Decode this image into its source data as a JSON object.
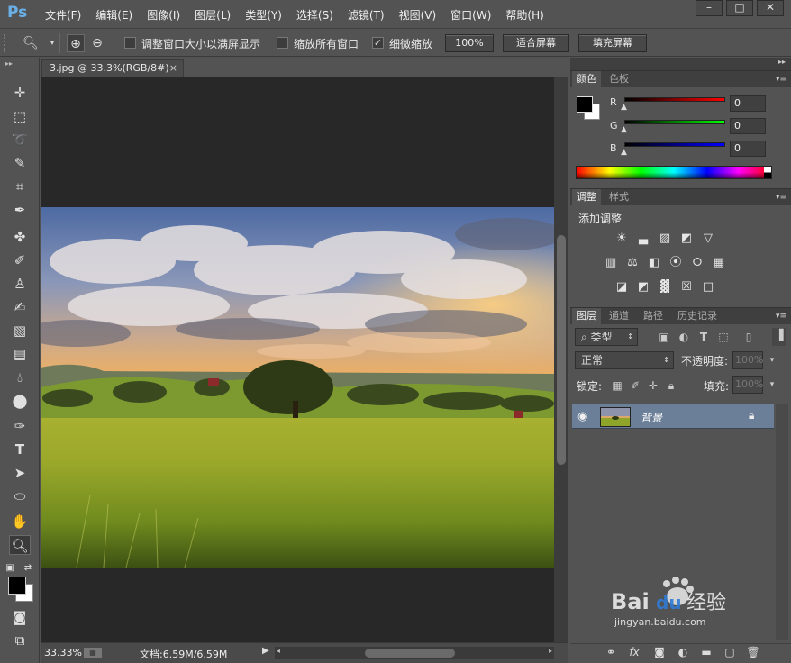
{
  "app": {
    "logo": "Ps"
  },
  "menubar": {
    "items": [
      "文件(F)",
      "编辑(E)",
      "图像(I)",
      "图层(L)",
      "类型(Y)",
      "选择(S)",
      "滤镜(T)",
      "视图(V)",
      "窗口(W)",
      "帮助(H)"
    ],
    "window_controls": [
      "minimize-icon",
      "maximize-icon",
      "close-icon"
    ]
  },
  "options": {
    "resize_windows": {
      "label": "调整窗口大小以满屏显示",
      "checked": false
    },
    "zoom_all": {
      "label": "缩放所有窗口",
      "checked": false
    },
    "scrubby_zoom": {
      "label": "细微缩放",
      "checked": true
    },
    "btn_100": "100%",
    "btn_fit": "适合屏幕",
    "btn_fill": "填充屏幕"
  },
  "document": {
    "tab_title": "3.jpg @ 33.3%(RGB/8#)",
    "zoom": "33.33%",
    "doc_size": "文档:6.59M/6.59M"
  },
  "color_panel": {
    "tabs": [
      "颜色",
      "色板"
    ],
    "channels": [
      {
        "label": "R",
        "value": "0",
        "color": "#ff0000"
      },
      {
        "label": "G",
        "value": "0",
        "color": "#00ff00"
      },
      {
        "label": "B",
        "value": "0",
        "color": "#0000ff"
      }
    ],
    "foreground": "#000000",
    "background": "#ffffff"
  },
  "adjustments_panel": {
    "tabs": [
      "调整",
      "样式"
    ],
    "title": "添加调整"
  },
  "layers_panel": {
    "tabs": [
      "图层",
      "通道",
      "路径",
      "历史记录"
    ],
    "filter_kind": "类型",
    "blend_mode": "正常",
    "opacity_label": "不透明度:",
    "opacity_value": "100%",
    "lock_label": "锁定:",
    "fill_label": "填充:",
    "fill_value": "100%",
    "layers": [
      {
        "name": "背景",
        "visible": true,
        "locked": true
      }
    ]
  }
}
